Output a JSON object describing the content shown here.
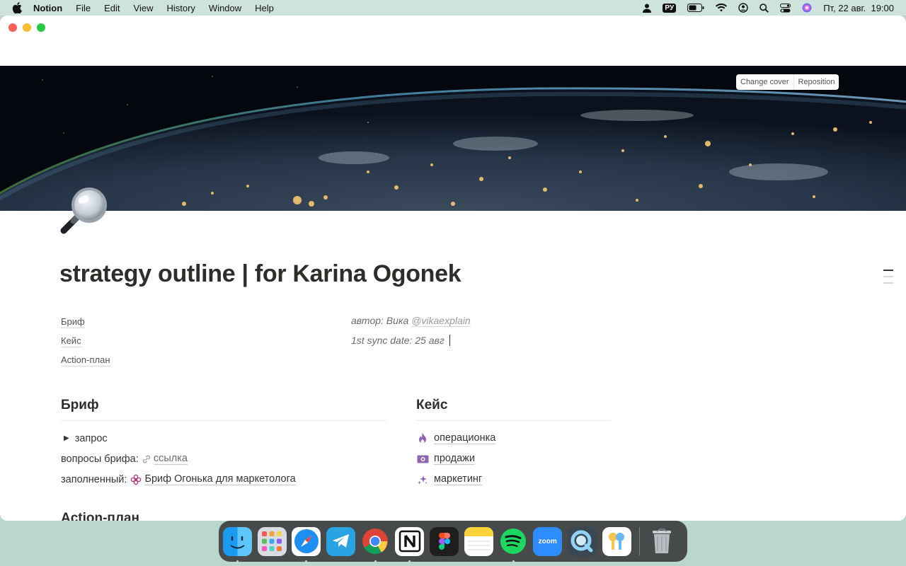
{
  "menubar": {
    "app": "Notion",
    "items": [
      "File",
      "Edit",
      "View",
      "History",
      "Window",
      "Help"
    ],
    "keyboard_layout": "РУ",
    "datetime": "Пт, 22 авг.  19:00",
    "icons": [
      "apple-icon",
      "user-icon",
      "battery-icon",
      "wifi-icon",
      "account-circle-icon",
      "search-icon",
      "control-center-icon",
      "siri-icon"
    ]
  },
  "cover": {
    "change_cover": "Change cover",
    "reposition": "Reposition"
  },
  "page": {
    "icon": "magnifying-glass-emoji",
    "title": "strategy outline | for Karina Ogonek",
    "anchors": [
      "Бриф",
      "Кейс",
      "Action-план"
    ],
    "author_prefix": "автор: Вика ",
    "author_mention": "@vikaexplain",
    "sync_date": "1st sync date: 25 авг "
  },
  "brief": {
    "heading": "Бриф",
    "toggle_label": "запрос",
    "questions_label": "вопросы брифа: ",
    "questions_link": "ссылка",
    "filled_label": "заполненный: ",
    "filled_link": "Бриф Огонька для маркетолога"
  },
  "case": {
    "heading": "Кейс",
    "items": [
      {
        "label": "операционка",
        "icon": "fire-icon"
      },
      {
        "label": "продажи",
        "icon": "money-icon"
      },
      {
        "label": "маркетинг",
        "icon": "sparkles-icon"
      }
    ]
  },
  "action_heading": "Action-план",
  "dock": {
    "apps": [
      {
        "name": "Finder",
        "running": true
      },
      {
        "name": "Launchpad",
        "running": false
      },
      {
        "name": "Safari",
        "running": true
      },
      {
        "name": "Telegram",
        "running": false
      },
      {
        "name": "Chrome",
        "running": true
      },
      {
        "name": "Notion",
        "running": true
      },
      {
        "name": "Figma",
        "running": false
      },
      {
        "name": "Notes",
        "running": false
      },
      {
        "name": "Spotify",
        "running": true
      },
      {
        "name": "Zoom",
        "running": false
      },
      {
        "name": "QuickTime Player",
        "running": false
      },
      {
        "name": "Keychain Access",
        "running": false
      },
      {
        "name": "Trash",
        "running": false
      }
    ],
    "zoom_label": "zoom"
  }
}
